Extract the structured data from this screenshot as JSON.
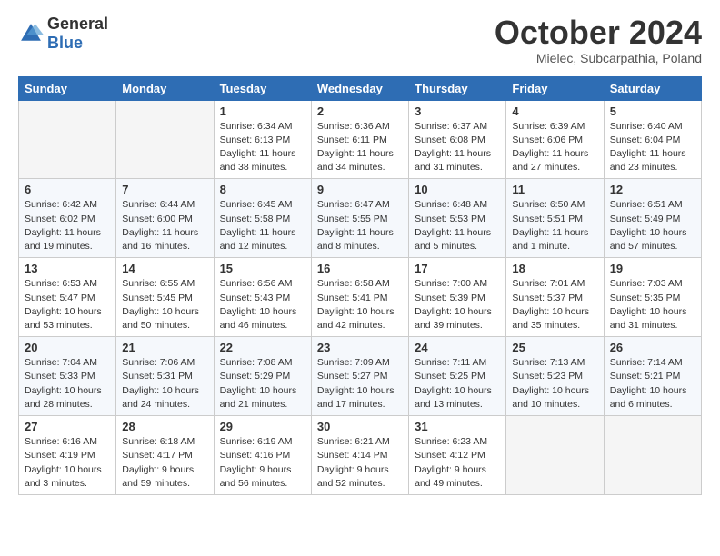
{
  "header": {
    "logo_general": "General",
    "logo_blue": "Blue",
    "month": "October 2024",
    "location": "Mielec, Subcarpathia, Poland"
  },
  "weekdays": [
    "Sunday",
    "Monday",
    "Tuesday",
    "Wednesday",
    "Thursday",
    "Friday",
    "Saturday"
  ],
  "weeks": [
    [
      {
        "day": "",
        "info": ""
      },
      {
        "day": "",
        "info": ""
      },
      {
        "day": "1",
        "info": "Sunrise: 6:34 AM\nSunset: 6:13 PM\nDaylight: 11 hours and 38 minutes."
      },
      {
        "day": "2",
        "info": "Sunrise: 6:36 AM\nSunset: 6:11 PM\nDaylight: 11 hours and 34 minutes."
      },
      {
        "day": "3",
        "info": "Sunrise: 6:37 AM\nSunset: 6:08 PM\nDaylight: 11 hours and 31 minutes."
      },
      {
        "day": "4",
        "info": "Sunrise: 6:39 AM\nSunset: 6:06 PM\nDaylight: 11 hours and 27 minutes."
      },
      {
        "day": "5",
        "info": "Sunrise: 6:40 AM\nSunset: 6:04 PM\nDaylight: 11 hours and 23 minutes."
      }
    ],
    [
      {
        "day": "6",
        "info": "Sunrise: 6:42 AM\nSunset: 6:02 PM\nDaylight: 11 hours and 19 minutes."
      },
      {
        "day": "7",
        "info": "Sunrise: 6:44 AM\nSunset: 6:00 PM\nDaylight: 11 hours and 16 minutes."
      },
      {
        "day": "8",
        "info": "Sunrise: 6:45 AM\nSunset: 5:58 PM\nDaylight: 11 hours and 12 minutes."
      },
      {
        "day": "9",
        "info": "Sunrise: 6:47 AM\nSunset: 5:55 PM\nDaylight: 11 hours and 8 minutes."
      },
      {
        "day": "10",
        "info": "Sunrise: 6:48 AM\nSunset: 5:53 PM\nDaylight: 11 hours and 5 minutes."
      },
      {
        "day": "11",
        "info": "Sunrise: 6:50 AM\nSunset: 5:51 PM\nDaylight: 11 hours and 1 minute."
      },
      {
        "day": "12",
        "info": "Sunrise: 6:51 AM\nSunset: 5:49 PM\nDaylight: 10 hours and 57 minutes."
      }
    ],
    [
      {
        "day": "13",
        "info": "Sunrise: 6:53 AM\nSunset: 5:47 PM\nDaylight: 10 hours and 53 minutes."
      },
      {
        "day": "14",
        "info": "Sunrise: 6:55 AM\nSunset: 5:45 PM\nDaylight: 10 hours and 50 minutes."
      },
      {
        "day": "15",
        "info": "Sunrise: 6:56 AM\nSunset: 5:43 PM\nDaylight: 10 hours and 46 minutes."
      },
      {
        "day": "16",
        "info": "Sunrise: 6:58 AM\nSunset: 5:41 PM\nDaylight: 10 hours and 42 minutes."
      },
      {
        "day": "17",
        "info": "Sunrise: 7:00 AM\nSunset: 5:39 PM\nDaylight: 10 hours and 39 minutes."
      },
      {
        "day": "18",
        "info": "Sunrise: 7:01 AM\nSunset: 5:37 PM\nDaylight: 10 hours and 35 minutes."
      },
      {
        "day": "19",
        "info": "Sunrise: 7:03 AM\nSunset: 5:35 PM\nDaylight: 10 hours and 31 minutes."
      }
    ],
    [
      {
        "day": "20",
        "info": "Sunrise: 7:04 AM\nSunset: 5:33 PM\nDaylight: 10 hours and 28 minutes."
      },
      {
        "day": "21",
        "info": "Sunrise: 7:06 AM\nSunset: 5:31 PM\nDaylight: 10 hours and 24 minutes."
      },
      {
        "day": "22",
        "info": "Sunrise: 7:08 AM\nSunset: 5:29 PM\nDaylight: 10 hours and 21 minutes."
      },
      {
        "day": "23",
        "info": "Sunrise: 7:09 AM\nSunset: 5:27 PM\nDaylight: 10 hours and 17 minutes."
      },
      {
        "day": "24",
        "info": "Sunrise: 7:11 AM\nSunset: 5:25 PM\nDaylight: 10 hours and 13 minutes."
      },
      {
        "day": "25",
        "info": "Sunrise: 7:13 AM\nSunset: 5:23 PM\nDaylight: 10 hours and 10 minutes."
      },
      {
        "day": "26",
        "info": "Sunrise: 7:14 AM\nSunset: 5:21 PM\nDaylight: 10 hours and 6 minutes."
      }
    ],
    [
      {
        "day": "27",
        "info": "Sunrise: 6:16 AM\nSunset: 4:19 PM\nDaylight: 10 hours and 3 minutes."
      },
      {
        "day": "28",
        "info": "Sunrise: 6:18 AM\nSunset: 4:17 PM\nDaylight: 9 hours and 59 minutes."
      },
      {
        "day": "29",
        "info": "Sunrise: 6:19 AM\nSunset: 4:16 PM\nDaylight: 9 hours and 56 minutes."
      },
      {
        "day": "30",
        "info": "Sunrise: 6:21 AM\nSunset: 4:14 PM\nDaylight: 9 hours and 52 minutes."
      },
      {
        "day": "31",
        "info": "Sunrise: 6:23 AM\nSunset: 4:12 PM\nDaylight: 9 hours and 49 minutes."
      },
      {
        "day": "",
        "info": ""
      },
      {
        "day": "",
        "info": ""
      }
    ]
  ]
}
